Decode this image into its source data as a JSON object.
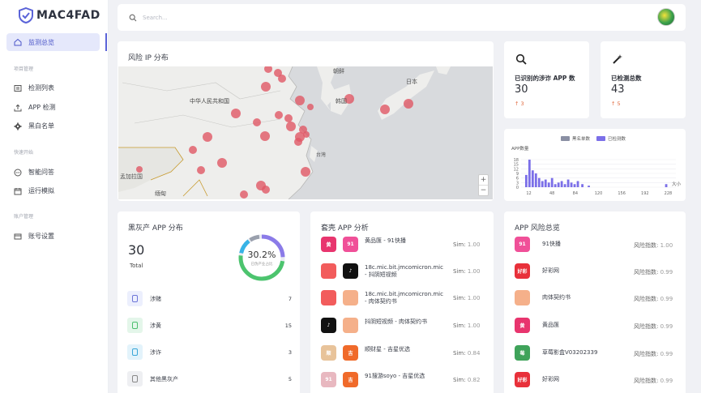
{
  "app": {
    "logo_text": "MAC4FAD"
  },
  "sidebar": {
    "active": {
      "label": "监测总览",
      "icon": "home-icon"
    },
    "sections": [
      {
        "label": "项目管理",
        "items": [
          {
            "label": "检测列表",
            "icon": "list-icon"
          },
          {
            "label": "APP 检测",
            "icon": "upload-icon"
          },
          {
            "label": "黑白名单",
            "icon": "gear-icon"
          }
        ]
      },
      {
        "label": "快速开始",
        "items": [
          {
            "label": "智能问答",
            "icon": "chat-icon"
          },
          {
            "label": "运行模拟",
            "icon": "calendar-icon"
          }
        ]
      },
      {
        "label": "账户管理",
        "items": [
          {
            "label": "账号设置",
            "icon": "card-icon"
          }
        ]
      }
    ]
  },
  "search": {
    "placeholder": "Search..."
  },
  "map_card": {
    "title": "风险 IP 分布",
    "labels": [
      "朝鲜",
      "日本",
      "中华人民共和国",
      "韩国",
      "台灣",
      "孟加拉国",
      "缅甸",
      "大小"
    ],
    "zoom_in": "+",
    "zoom_out": "−"
  },
  "stats": [
    {
      "icon": "search-icon",
      "label": "已识别的涉诈 APP 数",
      "value": "30",
      "delta": "3"
    },
    {
      "icon": "magic-wand-icon",
      "label": "已检测总数",
      "value": "43",
      "delta": "5"
    }
  ],
  "chart_data": {
    "type": "bar",
    "legend": [
      "黑名单数",
      "已检测数"
    ],
    "ylabel": "APP数量",
    "yticks": [
      "18",
      "15",
      "12",
      "9",
      "6",
      "3",
      "0"
    ],
    "xticks": [
      "12",
      "48",
      "84",
      "120",
      "156",
      "192",
      "228"
    ],
    "xlabel": "大小",
    "colors": {
      "blacklist": "#8a8fa3",
      "detected": "#7b6fe8"
    },
    "series": [
      {
        "name": "已检测数",
        "x": [
          8,
          13,
          18,
          23,
          28,
          33,
          38,
          43,
          48,
          53,
          58,
          63,
          68,
          73,
          78,
          83,
          88,
          95,
          105,
          225
        ],
        "values": [
          8,
          18,
          11,
          9,
          6,
          4,
          5,
          3,
          6,
          2,
          3,
          4,
          2,
          5,
          3,
          2,
          4,
          2,
          1,
          2
        ]
      }
    ]
  },
  "distribution": {
    "title": "黑灰产 APP 分布",
    "total_value": "30",
    "total_label": "Total",
    "donut_percent": "30.2%",
    "donut_caption": "已伪产业占比",
    "rows": [
      {
        "icon": "phone-icon",
        "label": "涉赌",
        "value": "7",
        "bg": "#eceffd",
        "fg": "#6c75d8"
      },
      {
        "icon": "leaf-icon",
        "label": "涉黄",
        "value": "15",
        "bg": "#e4f6ea",
        "fg": "#4cbf6e"
      },
      {
        "icon": "home-icon",
        "label": "涉诈",
        "value": "3",
        "bg": "#e3f3fb",
        "fg": "#3aa6d8"
      },
      {
        "icon": "more-icon",
        "label": "其他黑灰产",
        "value": "5",
        "bg": "#eeeff2",
        "fg": "#888"
      }
    ]
  },
  "analysis": {
    "title": "套壳 APP 分析",
    "sim_label": "Sim:",
    "rows": [
      {
        "name": "黄品匯 - 91快播",
        "sim": "1.00",
        "a": {
          "text": "黄",
          "color": "#e8356e"
        },
        "b": {
          "text": "91",
          "color": "#f05098"
        }
      },
      {
        "name": "18c.mic.bit.jmcomicron.mic - 抖阴短视频",
        "sim": "1.00",
        "a": {
          "text": "",
          "color": "#f25c5c"
        },
        "b": {
          "text": "♪",
          "color": "#111"
        }
      },
      {
        "name": "18c.mic.bit.jmcomicron.mic - 肉体契约书",
        "sim": "1.00",
        "a": {
          "text": "",
          "color": "#f25c5c"
        },
        "b": {
          "text": "",
          "color": "#f5b08a"
        }
      },
      {
        "name": "抖阴短视频 - 肉体契约书",
        "sim": "1.00",
        "a": {
          "text": "♪",
          "color": "#111"
        },
        "b": {
          "text": "",
          "color": "#f5b08a"
        }
      },
      {
        "name": "顺财星 - 吉星优选",
        "sim": "0.84",
        "a": {
          "text": "顺",
          "color": "#e8c39a"
        },
        "b": {
          "text": "吉",
          "color": "#f06a2a"
        }
      },
      {
        "name": "91搜游soyo - 吉星优选",
        "sim": "0.82",
        "a": {
          "text": "91",
          "color": "#e8b8c0"
        },
        "b": {
          "text": "吉",
          "color": "#f06a2a"
        }
      }
    ]
  },
  "risk": {
    "title": "APP 风险总览",
    "index_label": "风险指数:",
    "rows": [
      {
        "name": "91快播",
        "score": "1.00",
        "icon": {
          "text": "91",
          "color": "#f05098"
        }
      },
      {
        "name": "好彩网",
        "score": "0.99",
        "icon": {
          "text": "好彩",
          "color": "#e8303a"
        }
      },
      {
        "name": "肉体契约书",
        "score": "0.99",
        "icon": {
          "text": "",
          "color": "#f5b08a"
        }
      },
      {
        "name": "黄品匯",
        "score": "0.99",
        "icon": {
          "text": "黄",
          "color": "#e8356e"
        }
      },
      {
        "name": "草莓影盒V03202339",
        "score": "0.99",
        "icon": {
          "text": "莓",
          "color": "#3fa35a"
        }
      },
      {
        "name": "好彩网",
        "score": "0.99",
        "icon": {
          "text": "好彩",
          "color": "#e8303a"
        }
      }
    ]
  }
}
